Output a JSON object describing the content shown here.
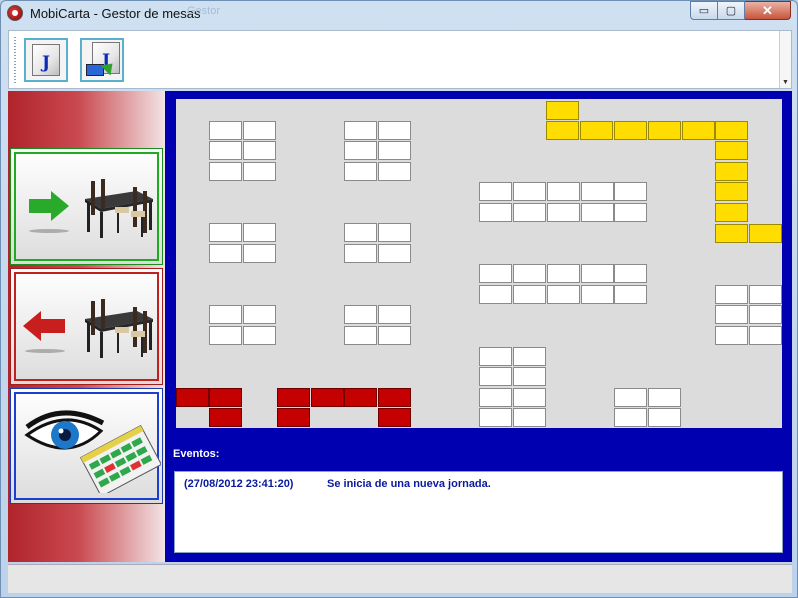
{
  "window": {
    "title": "MobiCarta - Gestor de mesas",
    "ghost_title": "Gestor"
  },
  "window_controls": {
    "minimize": "▭",
    "maximize": "▢",
    "close": "✕"
  },
  "toolbar": {
    "buttons": [
      {
        "name": "jornada-document",
        "glyph": "J"
      },
      {
        "name": "jornada-terminal",
        "glyph": "J"
      }
    ]
  },
  "sidebar": {
    "buttons": [
      "enter-tables",
      "exit-tables",
      "view-map"
    ]
  },
  "colors": {
    "free": "#ffffff",
    "occupied": "#ffdd00",
    "closed": "#c40000",
    "main_bg": "#0000b0"
  },
  "events": {
    "label": "Eventos:",
    "rows": [
      {
        "timestamp": "(27/08/2012 23:41:20)",
        "message": "Se inicia de una nueva jornada."
      }
    ]
  }
}
